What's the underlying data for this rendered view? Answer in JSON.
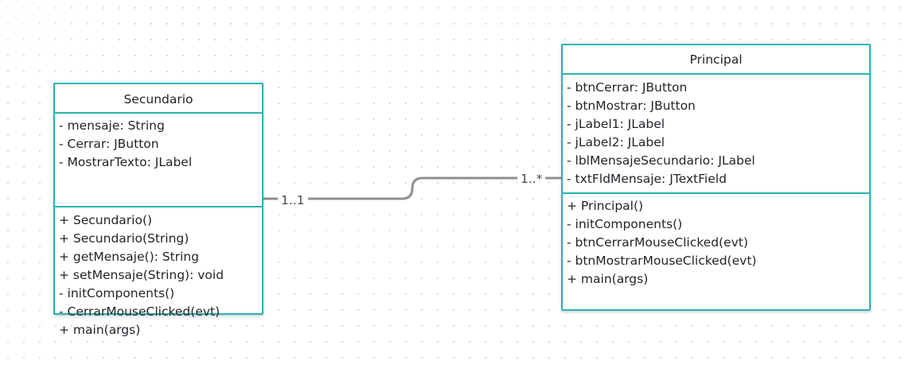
{
  "classes": {
    "secundario": {
      "name": "Secundario",
      "attributes": [
        "- mensaje: String",
        "- Cerrar: JButton",
        "- MostrarTexto: JLabel"
      ],
      "operations": [
        "+ Secundario()",
        "+ Secundario(String)",
        "+ getMensaje(): String",
        "+ setMensaje(String): void",
        "- initComponents()",
        "- CerrarMouseClicked(evt)",
        "+ main(args)"
      ]
    },
    "principal": {
      "name": "Principal",
      "attributes": [
        "- btnCerrar: JButton",
        "- btnMostrar: JButton",
        "- jLabel1: JLabel",
        "- jLabel2: JLabel",
        "- lblMensajeSecundario: JLabel",
        "- txtFldMensaje: JTextField"
      ],
      "operations": [
        "+ Principal()",
        "- initComponents()",
        "- btnCerrarMouseClicked(evt)",
        "- btnMostrarMouseClicked(evt)",
        "+ main(args)"
      ]
    }
  },
  "association": {
    "from": "Secundario",
    "to": "Principal",
    "multiplicity_from": "1..1",
    "multiplicity_to": "1..*"
  },
  "colors": {
    "class_border": "#2ab3b3",
    "connector": "#8c8f93",
    "canvas_dots": "#d9dde3"
  }
}
